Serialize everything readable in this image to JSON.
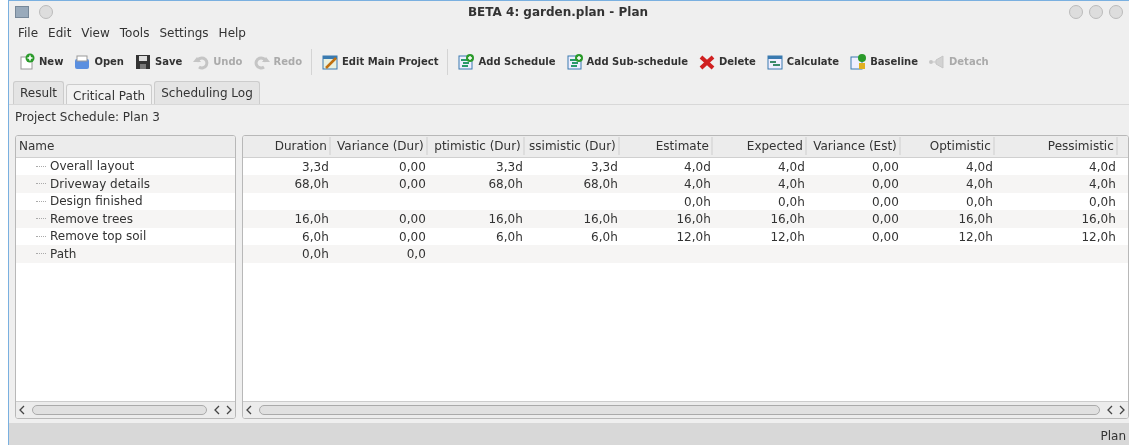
{
  "window": {
    "title": "BETA 4: garden.plan - Plan"
  },
  "menu": [
    "File",
    "Edit",
    "View",
    "Tools",
    "Settings",
    "Help"
  ],
  "toolbar": [
    [
      {
        "label": "New",
        "kind": "new",
        "disabled": false
      },
      {
        "label": "Open",
        "kind": "open",
        "disabled": false
      },
      {
        "label": "Save",
        "kind": "save",
        "disabled": false
      },
      {
        "label": "Undo",
        "kind": "undo",
        "disabled": true
      },
      {
        "label": "Redo",
        "kind": "redo",
        "disabled": true
      }
    ],
    [
      {
        "label": "Edit Main Project",
        "kind": "edit",
        "disabled": false
      }
    ],
    [
      {
        "label": "Add Schedule",
        "kind": "add",
        "disabled": false
      },
      {
        "label": "Add Sub-schedule",
        "kind": "add",
        "disabled": false
      },
      {
        "label": "Delete",
        "kind": "delete",
        "disabled": false
      },
      {
        "label": "Calculate",
        "kind": "calculate",
        "disabled": false
      },
      {
        "label": "Baseline",
        "kind": "baseline",
        "disabled": false
      },
      {
        "label": "Detach",
        "kind": "detach",
        "disabled": true
      }
    ]
  ],
  "tabs": [
    {
      "label": "Result",
      "selected": false
    },
    {
      "label": "Critical Path",
      "selected": true
    },
    {
      "label": "Scheduling Log",
      "selected": false
    }
  ],
  "schedule_label": "Project Schedule: Plan 3",
  "tree": {
    "header": "Name",
    "items": [
      {
        "name": "Overall layout"
      },
      {
        "name": "Driveway details"
      },
      {
        "name": "Design finished"
      },
      {
        "name": "Remove trees"
      },
      {
        "name": "Remove top soil"
      },
      {
        "name": "Path"
      }
    ]
  },
  "table": {
    "columns": [
      "Duration",
      "Variance (Dur)",
      "ptimistic (Dur)",
      "ssimistic (Dur)",
      "Estimate",
      "Expected",
      "Variance (Est)",
      "Optimistic",
      "Pessimistic"
    ],
    "rows": [
      [
        "3,3d",
        "0,00",
        "3,3d",
        "3,3d",
        "4,0d",
        "4,0d",
        "0,00",
        "4,0d",
        "4,0d"
      ],
      [
        "68,0h",
        "0,00",
        "68,0h",
        "68,0h",
        "4,0h",
        "4,0h",
        "0,00",
        "4,0h",
        "4,0h"
      ],
      [
        null,
        null,
        null,
        null,
        "0,0h",
        "0,0h",
        "0,00",
        "0,0h",
        "0,0h"
      ],
      [
        "16,0h",
        "0,00",
        "16,0h",
        "16,0h",
        "16,0h",
        "16,0h",
        "0,00",
        "16,0h",
        "16,0h"
      ],
      [
        "6,0h",
        "0,00",
        "6,0h",
        "6,0h",
        "12,0h",
        "12,0h",
        "0,00",
        "12,0h",
        "12,0h"
      ],
      [
        "0,0h",
        "0,0",
        null,
        null,
        null,
        null,
        null,
        null,
        null
      ]
    ]
  },
  "status_bar": "Plan"
}
